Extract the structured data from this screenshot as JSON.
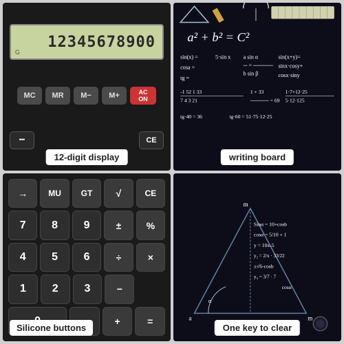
{
  "labels": {
    "top_left": "12-digit display",
    "top_right": "writing board",
    "bottom_left": "Silicone buttons",
    "bottom_right": "One key to clear"
  },
  "calculator": {
    "display_value": "12345678900",
    "display_g": "G",
    "top_buttons": [
      "MC",
      "MR",
      "M−",
      "M+",
      "AC/ON"
    ],
    "bottom_right_buttons": [
      "−",
      "CE"
    ]
  },
  "numpad": {
    "rows": [
      [
        "→",
        "MU",
        "GT",
        "√",
        "CE"
      ],
      [
        "7",
        "8",
        "9",
        "±",
        "%"
      ],
      [
        "4",
        "5",
        "6",
        "÷",
        "×"
      ],
      [
        "1",
        "2",
        "3",
        "−"
      ],
      [
        "0",
        ".",
        "="
      ]
    ]
  },
  "math_top": {
    "equation": "a² + b² = C²",
    "lines": [
      "sin(x)",
      "cosa =",
      "tg ="
    ]
  },
  "math_bottom": {
    "equation": "Sina = 10+cosb",
    "lines": [
      "cosa = 5/10 + 1",
      "y = 10x-5",
      "y = 2/x * 33/22",
      "±√6-cosb",
      "y3 = 3/7 * 7"
    ]
  }
}
